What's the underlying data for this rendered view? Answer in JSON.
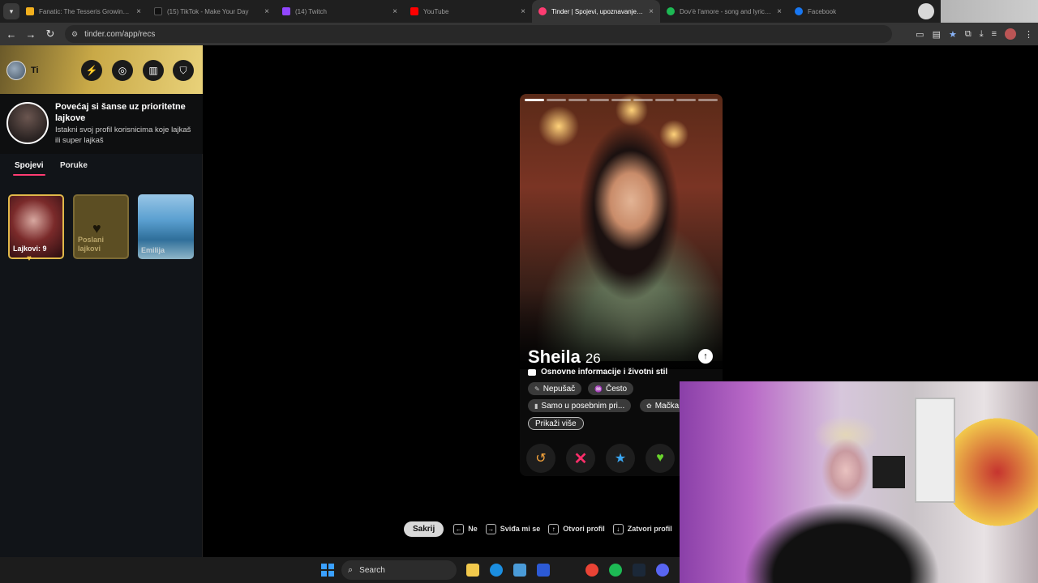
{
  "browser": {
    "tabs": [
      {
        "title": "Fanatic: The Tesseris Growing o...",
        "color": "#f2b01e",
        "active": false
      },
      {
        "title": "(15) TikTok - Make Your Day",
        "color": "#111111",
        "active": false
      },
      {
        "title": "(14) Twitch",
        "color": "#9146ff",
        "active": false
      },
      {
        "title": "YouTube",
        "color": "#ff0000",
        "active": false
      },
      {
        "title": "Tinder | Spojevi, upoznavanje p...",
        "color": "#fe3c72",
        "active": true
      },
      {
        "title": "Dov'è l'amore - song and lyrics ...",
        "color": "#1db954",
        "active": false
      },
      {
        "title": "Facebook",
        "color": "#1877f2",
        "active": false
      }
    ],
    "url": "tinder.com/app/recs",
    "accent": "#8ab4f8"
  },
  "sidebar": {
    "me_label": "Ti",
    "promo": {
      "title": "Povećaj si šanse uz prioritetne lajkove",
      "desc": "Istakni svoj profil korisnicima koje lajkaš ili super lajkaš"
    },
    "tabs": [
      {
        "label": "Spojevi",
        "active": true
      },
      {
        "label": "Poruke",
        "active": false
      }
    ],
    "cards": [
      {
        "label": "Lajkovi: 9"
      },
      {
        "label": "Poslani lajkovi"
      },
      {
        "label": "Emilija"
      }
    ],
    "header_icons": [
      "boost-icon",
      "explore-icon",
      "passport-icon",
      "safety-shield-icon"
    ]
  },
  "profile": {
    "name": "Sheila",
    "age": "26",
    "section": "Osnovne informacije i životni stil",
    "chips": [
      "Nepušač",
      "Često",
      "Samo u posebnim pri...",
      "Mačka"
    ],
    "show_more": "Prikaži više",
    "photo_count": 9,
    "current_photo": 1
  },
  "hints": {
    "hide": "Sakrij",
    "items": [
      {
        "key": "←",
        "label": "Ne"
      },
      {
        "key": "→",
        "label": "Sviđa mi se"
      },
      {
        "key": "↑",
        "label": "Otvori profil"
      },
      {
        "key": "↓",
        "label": "Zatvori profil"
      }
    ]
  },
  "taskbar": {
    "search": "Search"
  },
  "colors": {
    "tinder_pink": "#fe3c72",
    "gold": "#e0b84a"
  }
}
